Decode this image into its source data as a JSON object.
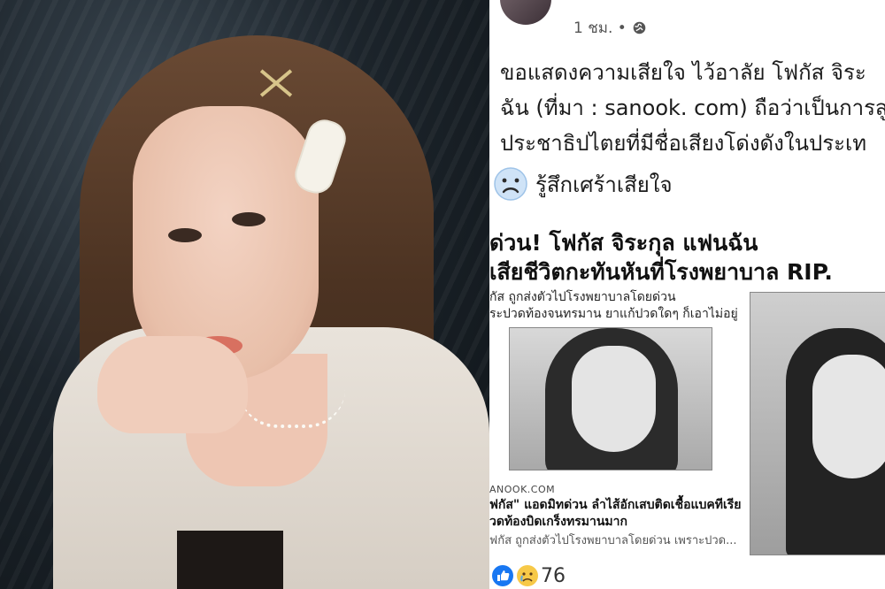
{
  "post": {
    "time": "1 ชม. •",
    "text_lines": [
      "ขอแสดงความเสียใจ ไว้อาลัย โฟกัส จิระ",
      "ฉัน (ที่มา : sanook. com) ถือว่าเป็นการสู",
      "ประชาธิปไตยที่มีชื่อเสียงโด่งดังในประเท"
    ],
    "feeling": "รู้สึกเศร้าเสียใจ",
    "headline": [
      "ด่วน! โฟกัส จิระกุล แฟนฉัน",
      "เสียชีวิตกะทันหันที่โรงพยาบาล RIP."
    ],
    "snippet": [
      "กัส ถูกส่งตัวไปโรงพยาบาลโดยด่วน",
      "ระปวดท้องจนทรมาน ยาแก้ปวดใดๆ ก็เอาไม่อยู่"
    ],
    "article": {
      "source": "ANOOK.COM",
      "title": [
        "ฟกัส\" แอดมิทด่วน ลำไส้อักเสบติดเชื้อแบคทีเรีย",
        "วดท้องบิดเกร็งทรมานมาก"
      ],
      "desc": "ฟกัส ถูกส่งตัวไปโรงพยาบาลโดยด่วน เพราะปวด..."
    },
    "reaction_count": "76"
  }
}
